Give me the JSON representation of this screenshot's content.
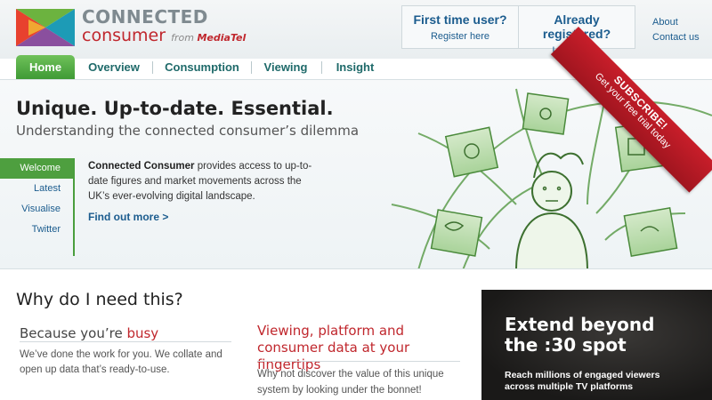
{
  "brand": {
    "line1": "CONNECTED",
    "line2": "consumer",
    "from": "from ",
    "from_brand": "MediaTel"
  },
  "login": {
    "first": {
      "question": "First time user?",
      "action": "Register here"
    },
    "registered": {
      "question": "Already registered?",
      "action": "Log in here"
    }
  },
  "toplinks": {
    "about": "About",
    "contact": "Contact us"
  },
  "nav": [
    "Home",
    "Overview",
    "Consumption",
    "Viewing",
    "Insight"
  ],
  "hero": {
    "title": "Unique.  Up-to-date.  Essential.",
    "subtitle": "Understanding the connected consumer’s dilemma",
    "side_nav": [
      "Welcome",
      "Latest",
      "Visualise",
      "Twitter"
    ],
    "text_bold": "Connected Consumer",
    "text": " provides access to up-to-date figures and market movements across the UK’s ever-evolving digital landscape.",
    "link": "Find out more >"
  },
  "ribbon": {
    "title": "SUBSCRIBE!",
    "subtitle": "Get your free trial today"
  },
  "why": {
    "heading": "Why do I need this?",
    "busy_prefix": "Because you’re ",
    "busy_word": "busy",
    "busy_text": "We’ve done the work for you. We collate and open up data that’s ready-to-use.",
    "vp_heading": "Viewing, platform and consumer data at your fingertips",
    "vp_text": "Why not discover the value of this unique system by looking under the bonnet!"
  },
  "ad": {
    "line1": "Extend beyond",
    "line2": "the :30 spot",
    "body": "Reach millions of engaged viewers across multiple TV platforms"
  },
  "colors": {
    "green": "#4e9f3f",
    "red": "#c0272d",
    "blue": "#1b5c8e"
  }
}
